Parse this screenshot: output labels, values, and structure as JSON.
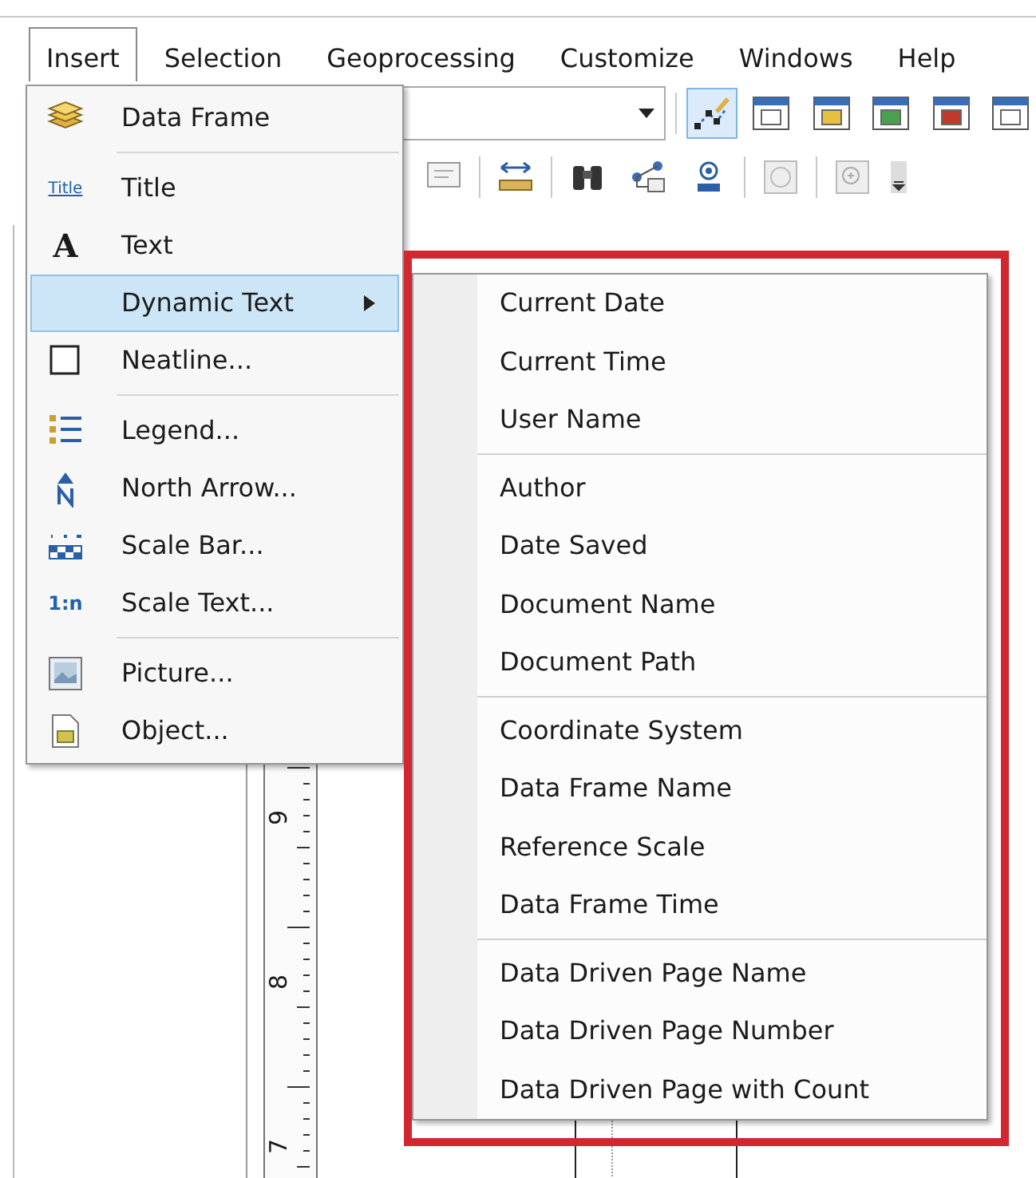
{
  "menubar": [
    {
      "label": "Insert",
      "selected": true
    },
    {
      "label": "Selection",
      "selected": false
    },
    {
      "label": "Geoprocessing",
      "selected": false
    },
    {
      "label": "Customize",
      "selected": false
    },
    {
      "label": "Windows",
      "selected": false
    },
    {
      "label": "Help",
      "selected": false
    }
  ],
  "insert_menu": {
    "groups": [
      [
        {
          "label": "Data Frame",
          "selected": false
        }
      ],
      [
        {
          "label": "Title",
          "icon_text": "Title",
          "selected": false
        },
        {
          "label": "Text",
          "icon_text": "A",
          "selected": false
        },
        {
          "label": "Dynamic Text",
          "selected": true,
          "has_submenu": true
        },
        {
          "label": "Neatline...",
          "selected": false
        }
      ],
      [
        {
          "label": "Legend...",
          "selected": false
        },
        {
          "label": "North Arrow...",
          "selected": false
        },
        {
          "label": "Scale Bar...",
          "selected": false
        },
        {
          "label": "Scale Text...",
          "icon_text": "1:n",
          "selected": false
        }
      ],
      [
        {
          "label": "Picture...",
          "selected": false
        },
        {
          "label": "Object...",
          "selected": false
        }
      ]
    ]
  },
  "dynamic_text_submenu": {
    "groups": [
      [
        "Current Date",
        "Current Time",
        "User Name"
      ],
      [
        "Author",
        "Date Saved",
        "Document Name",
        "Document Path"
      ],
      [
        "Coordinate System",
        "Data Frame Name",
        "Reference Scale",
        "Data Frame Time"
      ],
      [
        "Data Driven Page Name",
        "Data Driven Page Number",
        "Data Driven Page with Count"
      ]
    ]
  },
  "ruler": {
    "labels": [
      "9",
      "8",
      "7"
    ]
  }
}
